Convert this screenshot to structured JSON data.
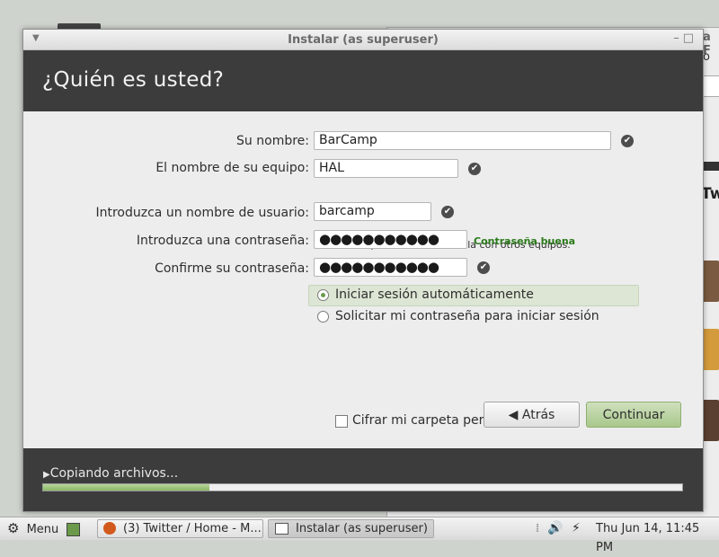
{
  "background": {
    "title_fragment": "a F",
    "title_fragment2": "o",
    "section_fragment": "Twe"
  },
  "dialog": {
    "window_title": "Instalar (as superuser)",
    "heading": "¿Quién es usted?",
    "fields": {
      "name_label": "Su nombre:",
      "name_value": "BarCamp",
      "computer_label": "El nombre de su equipo:",
      "computer_value": "HAL",
      "computer_hint": "El nombre que usa cuando habla con otros equipos.",
      "username_label": "Introduzca un nombre de usuario:",
      "username_value": "barcamp",
      "password_label": "Introduzca una contraseña:",
      "password_value": "●●●●●●●●●●●",
      "password_strength": "Contraseña buena",
      "confirm_label": "Confirme su contraseña:",
      "confirm_value": "●●●●●●●●●●●"
    },
    "login_options": {
      "auto_login": "Iniciar sesión automáticamente",
      "require_password": "Solicitar mi contraseña para iniciar sesión",
      "encrypt_home": "Cifrar mi carpeta personal",
      "selected": "auto_login",
      "encrypt_checked": false
    },
    "buttons": {
      "back": "Atrás",
      "continue": "Continuar"
    },
    "progress": {
      "label": "Copiando archivos...",
      "fraction": 0.26
    }
  },
  "taskbar": {
    "menu_label": "Menu",
    "tasks": [
      {
        "label": "(3) Twitter / Home - M..."
      },
      {
        "label": "Instalar (as superuser)"
      }
    ],
    "clock": "Thu Jun 14, 11:45 PM"
  },
  "colors": {
    "accent_green": "#a9c88c",
    "header_dark": "#3c3c3c",
    "strength_good": "#2a7a1a"
  }
}
